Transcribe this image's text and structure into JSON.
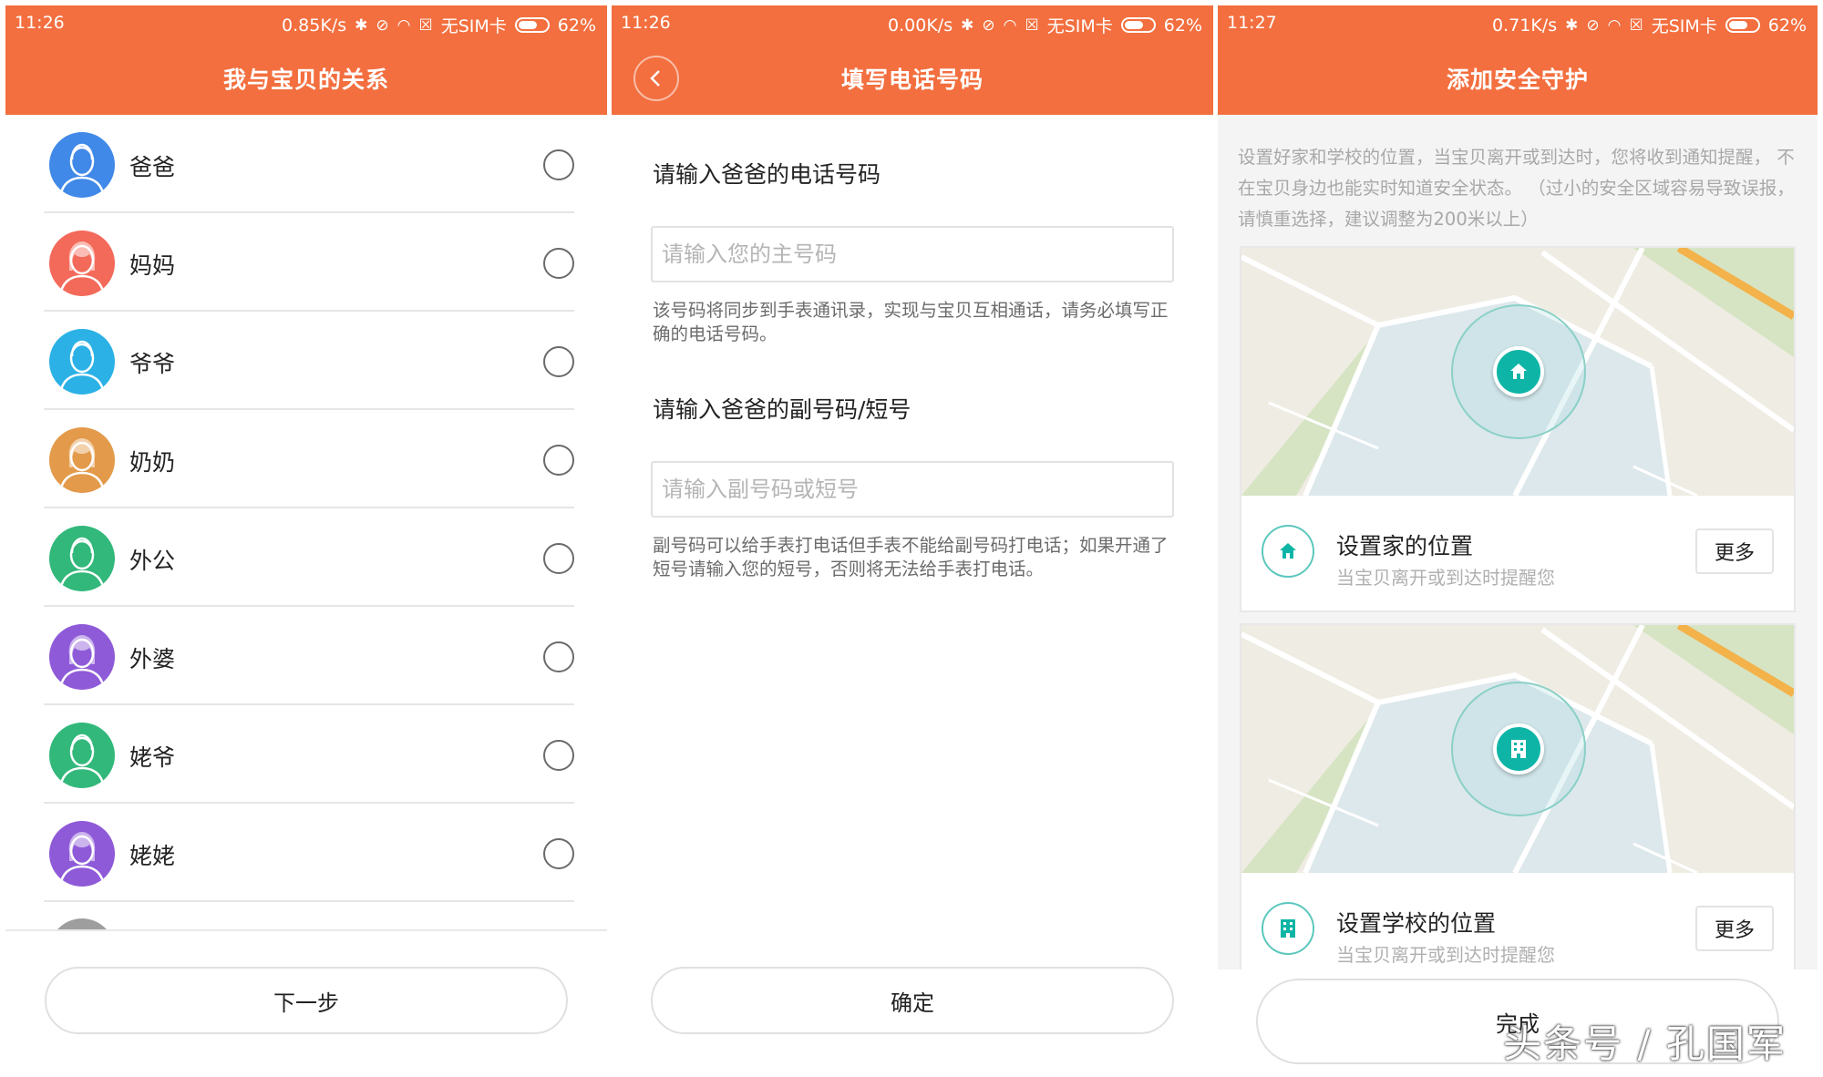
{
  "screen1": {
    "status": {
      "time": "11:26",
      "speed": "0.85K/s",
      "sim": "无SIM卡",
      "battery": "62%"
    },
    "title": "我与宝贝的关系",
    "relations": [
      {
        "label": "爸爸",
        "color": "#4089e8",
        "gender": "male"
      },
      {
        "label": "妈妈",
        "color": "#f36a5a",
        "gender": "female"
      },
      {
        "label": "爷爷",
        "color": "#2bb1e6",
        "gender": "male"
      },
      {
        "label": "奶奶",
        "color": "#e39a4a",
        "gender": "female"
      },
      {
        "label": "外公",
        "color": "#31b87a",
        "gender": "male"
      },
      {
        "label": "外婆",
        "color": "#8e5ad8",
        "gender": "female"
      },
      {
        "label": "姥爷",
        "color": "#31b87a",
        "gender": "male"
      },
      {
        "label": "姥姥",
        "color": "#8e5ad8",
        "gender": "female"
      }
    ],
    "next_label": "下一步"
  },
  "screen2": {
    "status": {
      "time": "11:26",
      "speed": "0.00K/s",
      "sim": "无SIM卡",
      "battery": "62%"
    },
    "title": "填写电话号码",
    "primary_label": "请输入爸爸的电话号码",
    "primary_placeholder": "请输入您的主号码",
    "primary_hint": "该号码将同步到手表通讯录，实现与宝贝互相通话，请务必填写正确的电话号码。",
    "secondary_label": "请输入爸爸的副号码/短号",
    "secondary_placeholder": "请输入副号码或短号",
    "secondary_hint": "副号码可以给手表打电话但手表不能给副号码打电话；如果开通了短号请输入您的短号，否则将无法给手表打电话。",
    "confirm_label": "确定"
  },
  "screen3": {
    "status": {
      "time": "11:27",
      "speed": "0.71K/s",
      "sim": "无SIM卡",
      "battery": "62%"
    },
    "title": "添加安全守护",
    "description": "设置好家和学校的位置，当宝贝离开或到达时，您将收到通知提醒， 不在宝贝身边也能实时知道安全状态。 （过小的安全区域容易导致误报，请慎重选择，建议调整为200米以上）",
    "home": {
      "title": "设置家的位置",
      "subtitle": "当宝贝离开或到达时提醒您",
      "more": "更多"
    },
    "school": {
      "title": "设置学校的位置",
      "subtitle": "当宝贝离开或到达时提醒您",
      "more": "更多"
    },
    "done_label": "完成",
    "accent_color": "#0eb5a6"
  },
  "header_color": "#f36f3f",
  "watermark": "头条号 / 孔国军"
}
